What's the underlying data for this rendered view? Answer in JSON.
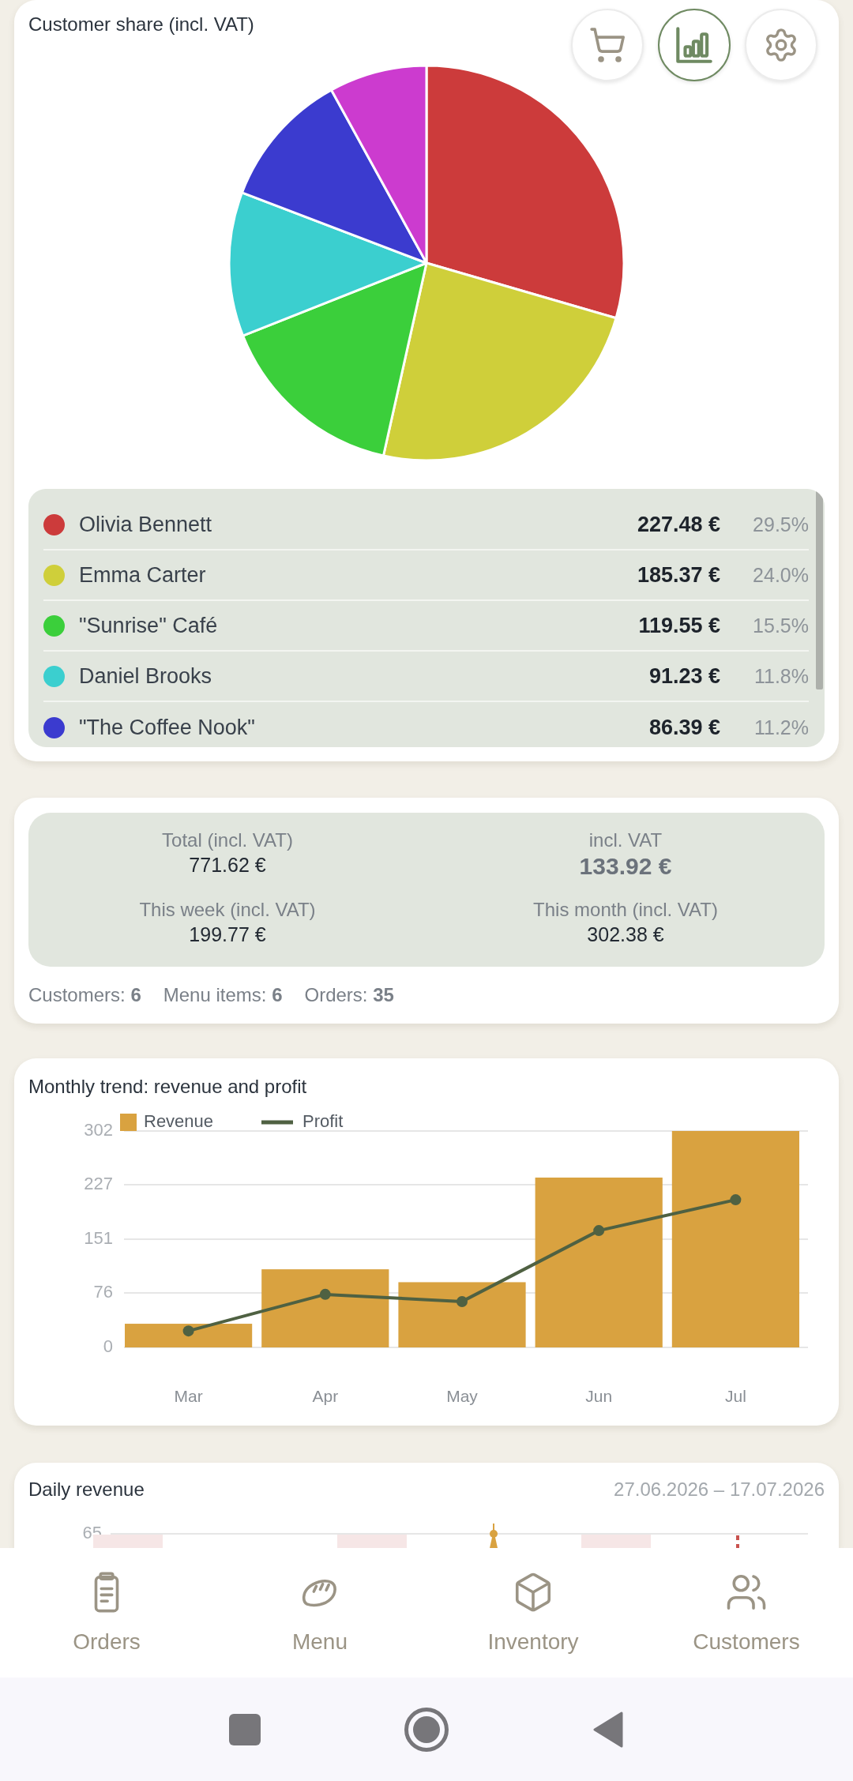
{
  "customer_share": {
    "title": "Customer share (incl. VAT)",
    "toolbar": [
      {
        "kind": "cart",
        "selected": false
      },
      {
        "kind": "chart",
        "selected": true
      },
      {
        "kind": "settings",
        "selected": false
      }
    ],
    "chart_data": {
      "type": "pie",
      "values": [
        29.5,
        24.0,
        15.5,
        11.8,
        11.2,
        8.0
      ]
    },
    "customers": [
      {
        "name": "Olivia Bennett",
        "color": "#cc3b3b",
        "amount": "227.48 €",
        "share": "29.5%"
      },
      {
        "name": "Emma Carter",
        "color": "#cfcf3a",
        "amount": "185.37 €",
        "share": "24.0%"
      },
      {
        "name": "\"Sunrise\" Café",
        "color": "#3bcf3b",
        "amount": "119.55 €",
        "share": "15.5%"
      },
      {
        "name": "Daniel Brooks",
        "color": "#3bcfcf",
        "amount": "91.23 €",
        "share": "11.8%"
      },
      {
        "name": "\"The Coffee Nook\"",
        "color": "#3b3bcf",
        "amount": "86.39 €",
        "share": "11.2%"
      }
    ]
  },
  "summary": {
    "cells": [
      {
        "label": "Total (incl. VAT)",
        "value": "771.62 €",
        "kind": "plain"
      },
      {
        "label": "incl. VAT",
        "value": "133.92 €",
        "kind": "large"
      },
      {
        "label": "This week (incl. VAT)",
        "value": "199.77 €",
        "kind": "plain"
      },
      {
        "label": "This month (incl. VAT)",
        "value": "302.38 €",
        "kind": "plain"
      }
    ],
    "counts": [
      "Customers: **6**",
      "Menu items: **6**",
      "Orders: **35**"
    ]
  },
  "monthly_trend": {
    "title": "Monthly trend: revenue and profit",
    "chart_data": {
      "type": "bar",
      "categories": [
        "Mar",
        "Apr",
        "May",
        "Jun",
        "Jul"
      ],
      "series": [
        {
          "name": "Revenue",
          "color": "#d9a240",
          "values": [
            33,
            109,
            91,
            237,
            302
          ]
        },
        {
          "name": "Profit",
          "type": "line",
          "marker": "circle",
          "color": "#4f6142",
          "values": [
            23,
            74,
            64,
            163,
            206
          ]
        }
      ],
      "ylim": [
        0,
        302
      ],
      "yticks": [
        0,
        76,
        151,
        227,
        302
      ],
      "grid": true,
      "legend": "top"
    }
  },
  "daily_revenue": {
    "title": "Daily revenue",
    "date_range": "27.06.2026 – 17.07.2026",
    "y_tick": "65"
  },
  "bottom_nav": [
    {
      "label": "Orders",
      "kind": "orders",
      "selected": false
    },
    {
      "label": "Menu",
      "kind": "menu",
      "selected": false
    },
    {
      "label": "Inventory",
      "kind": "inventory",
      "selected": false
    },
    {
      "label": "Customers",
      "kind": "customers",
      "selected": false
    }
  ]
}
